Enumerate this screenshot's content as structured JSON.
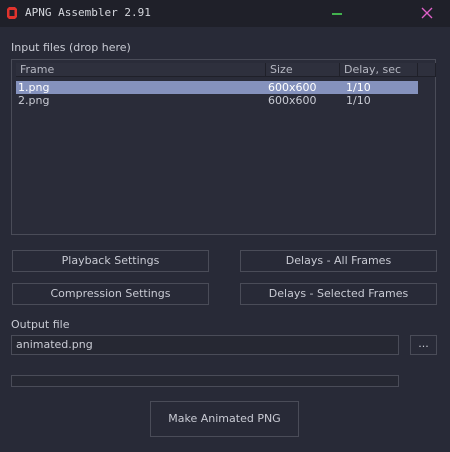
{
  "window": {
    "title": "APNG Assembler 2.91",
    "accent_color": "#8592bd",
    "icons": [
      "app-logo-icon",
      "minimize-icon",
      "close-icon"
    ]
  },
  "input": {
    "label": "Input files (drop here)",
    "columns": [
      "Frame",
      "Size",
      "Delay, sec"
    ],
    "rows": [
      {
        "frame": "1.png",
        "size": "600x600",
        "delay": "1/10",
        "selected": true
      },
      {
        "frame": "2.png",
        "size": "600x600",
        "delay": "1/10",
        "selected": false
      }
    ]
  },
  "buttons": {
    "playback": "Playback Settings",
    "delays_all": "Delays - All Frames",
    "compression": "Compression Settings",
    "delays_selected": "Delays - Selected Frames",
    "browse": "...",
    "make": "Make Animated PNG"
  },
  "output": {
    "label": "Output file",
    "value": "animated.png"
  },
  "progress": {
    "value": 0
  }
}
